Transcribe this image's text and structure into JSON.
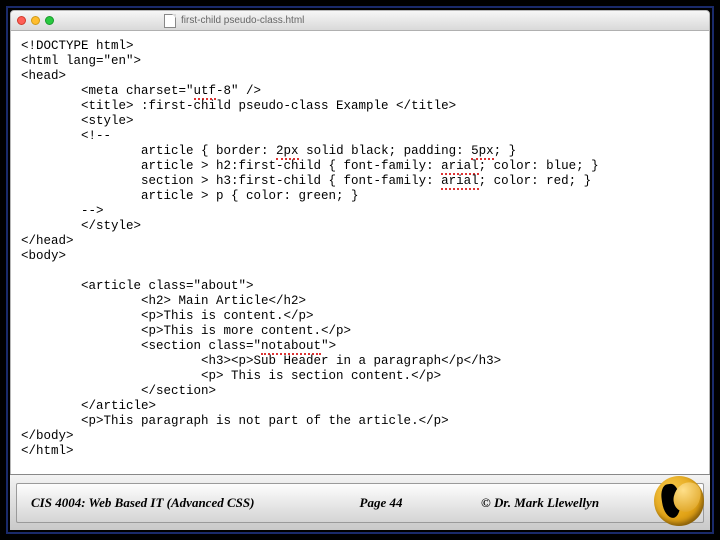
{
  "window": {
    "tab_filename": "first-child pseudo-class.html"
  },
  "code": {
    "l01": "<!DOCTYPE html>",
    "l02": "<html lang=\"en\">",
    "l03": "<head>",
    "l04a": "        <meta charset=\"",
    "l04b": "utf",
    "l04c": "-8\" />",
    "l05": "        <title> :first-child pseudo-class Example </title>",
    "l06": "        <style>",
    "l07": "        <!--",
    "l08a": "                article { border: ",
    "l08b": "2px",
    "l08c": " solid black; padding: ",
    "l08d": "5px",
    "l08e": "; }",
    "l09a": "                article > h2:first-child { font-family: ",
    "l09b": "arial",
    "l09c": "; color: blue; }",
    "l10a": "                section > h3:first-child { font-family: ",
    "l10b": "arial",
    "l10c": "; color: red; }",
    "l11": "                article > p { color: green; }",
    "l12": "        -->",
    "l13": "        </style>",
    "l14": "</head>",
    "l15": "<body>",
    "l16": "",
    "l17": "        <article class=\"about\">",
    "l18": "                <h2> Main Article</h2>",
    "l19": "                <p>This is content.</p>",
    "l20": "                <p>This is more content.</p>",
    "l21a": "                <section class=\"",
    "l21b": "notabout",
    "l21c": "\">",
    "l22": "                        <h3><p>Sub Header in a paragraph</p</h3>",
    "l23": "                        <p> This is section content.</p>",
    "l24": "                </section>",
    "l25": "        </article>",
    "l26": "        <p>This paragraph is not part of the article.</p>",
    "l27": "</body>",
    "l28": "</html>"
  },
  "footer": {
    "course": "CIS 4004: Web Based IT (Advanced CSS)",
    "page": "Page 44",
    "author": "© Dr. Mark Llewellyn"
  }
}
